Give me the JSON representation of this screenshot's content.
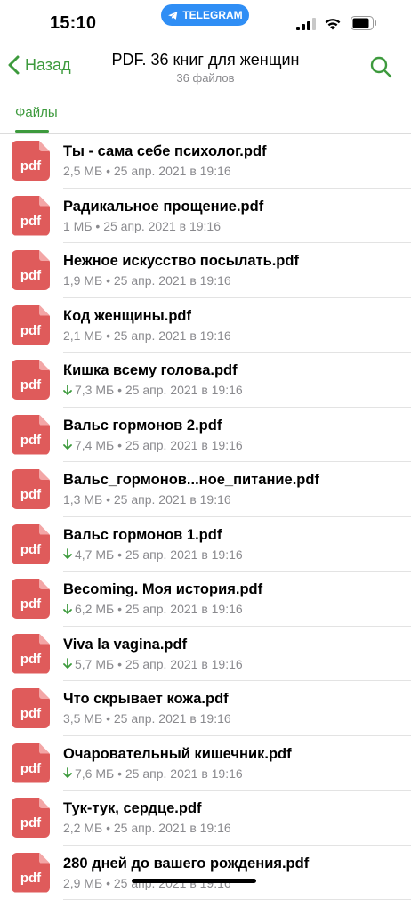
{
  "status_bar": {
    "time": "15:10",
    "app_pill": "TELEGRAM"
  },
  "header": {
    "back_label": "Назад",
    "title": "PDF. 36 книг для женщин",
    "subtitle": "36 файлов"
  },
  "tabs": [
    {
      "label": "Файлы",
      "active": true
    }
  ],
  "colors": {
    "accent": "#3d9a3d",
    "pdf_icon": "#df5b5b",
    "pill": "#2f8ef5"
  },
  "files": [
    {
      "icon_label": "pdf",
      "name": "Ты - сама себе психолог.pdf",
      "size": "2,5 МБ",
      "date": "25 апр. 2021 в 19:16",
      "downloadable": false
    },
    {
      "icon_label": "pdf",
      "name": "Радикальное прощение.pdf",
      "size": "1 МБ",
      "date": "25 апр. 2021 в 19:16",
      "downloadable": false
    },
    {
      "icon_label": "pdf",
      "name": "Нежное искусство посылать.pdf",
      "size": "1,9 МБ",
      "date": "25 апр. 2021 в 19:16",
      "downloadable": false
    },
    {
      "icon_label": "pdf",
      "name": "Код женщины.pdf",
      "size": "2,1 МБ",
      "date": "25 апр. 2021 в 19:16",
      "downloadable": false
    },
    {
      "icon_label": "pdf",
      "name": "Кишка всему голова.pdf",
      "size": "7,3 МБ",
      "date": "25 апр. 2021 в 19:16",
      "downloadable": true
    },
    {
      "icon_label": "pdf",
      "name": "Вальс гормонов 2.pdf",
      "size": "7,4 МБ",
      "date": "25 апр. 2021 в 19:16",
      "downloadable": true
    },
    {
      "icon_label": "pdf",
      "name": "Вальс_гормонов...ное_питание.pdf",
      "size": "1,3 МБ",
      "date": "25 апр. 2021 в 19:16",
      "downloadable": false
    },
    {
      "icon_label": "pdf",
      "name": "Вальс гормонов 1.pdf",
      "size": "4,7 МБ",
      "date": "25 апр. 2021 в 19:16",
      "downloadable": true
    },
    {
      "icon_label": "pdf",
      "name": "Becoming. Моя история.pdf",
      "size": "6,2 МБ",
      "date": "25 апр. 2021 в 19:16",
      "downloadable": true
    },
    {
      "icon_label": "pdf",
      "name": "Viva la vagina.pdf",
      "size": "5,7 МБ",
      "date": "25 апр. 2021 в 19:16",
      "downloadable": true
    },
    {
      "icon_label": "pdf",
      "name": "Что скрывает кожа.pdf",
      "size": "3,5 МБ",
      "date": "25 апр. 2021 в 19:16",
      "downloadable": false
    },
    {
      "icon_label": "pdf",
      "name": "Очаровательный кишечник.pdf",
      "size": "7,6 МБ",
      "date": "25 апр. 2021 в 19:16",
      "downloadable": true
    },
    {
      "icon_label": "pdf",
      "name": "Тук-тук, сердце.pdf",
      "size": "2,2 МБ",
      "date": "25 апр. 2021 в 19:16",
      "downloadable": false
    },
    {
      "icon_label": "pdf",
      "name": "280 дней до вашего рождения.pdf",
      "size": "2,9 МБ",
      "date": "25 апр. 2021 в 19:16",
      "downloadable": false
    }
  ]
}
